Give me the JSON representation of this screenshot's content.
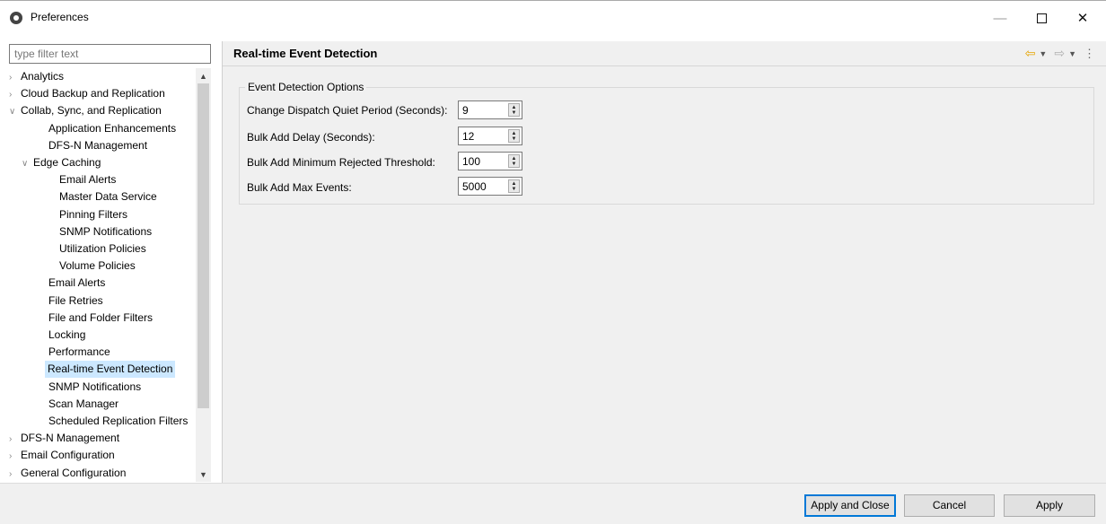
{
  "window": {
    "title": "Preferences",
    "minimize": "—",
    "close": "✕"
  },
  "filter": {
    "placeholder": "type filter text"
  },
  "tree": [
    {
      "label": "Analytics",
      "twisty": ">",
      "indent": 0
    },
    {
      "label": "Cloud Backup and Replication",
      "twisty": ">",
      "indent": 0
    },
    {
      "label": "Collab, Sync, and Replication",
      "twisty": "v",
      "indent": 0
    },
    {
      "label": "Application Enhancements",
      "twisty": "",
      "indent": 1
    },
    {
      "label": "DFS-N Management",
      "twisty": "",
      "indent": 1
    },
    {
      "label": "Edge Caching",
      "twisty": "v",
      "indent": 1
    },
    {
      "label": "Email Alerts",
      "twisty": "",
      "indent": 2
    },
    {
      "label": "Master Data Service",
      "twisty": "",
      "indent": 2
    },
    {
      "label": "Pinning Filters",
      "twisty": "",
      "indent": 2
    },
    {
      "label": "SNMP Notifications",
      "twisty": "",
      "indent": 2
    },
    {
      "label": "Utilization Policies",
      "twisty": "",
      "indent": 2
    },
    {
      "label": "Volume Policies",
      "twisty": "",
      "indent": 2
    },
    {
      "label": "Email Alerts",
      "twisty": "",
      "indent": 1
    },
    {
      "label": "File Retries",
      "twisty": "",
      "indent": 1
    },
    {
      "label": "File and Folder Filters",
      "twisty": "",
      "indent": 1
    },
    {
      "label": "Locking",
      "twisty": "",
      "indent": 1
    },
    {
      "label": "Performance",
      "twisty": "",
      "indent": 1
    },
    {
      "label": "Real-time Event Detection",
      "twisty": "",
      "indent": 1,
      "selected": true
    },
    {
      "label": "SNMP Notifications",
      "twisty": "",
      "indent": 1
    },
    {
      "label": "Scan Manager",
      "twisty": "",
      "indent": 1
    },
    {
      "label": "Scheduled Replication Filters",
      "twisty": "",
      "indent": 1
    },
    {
      "label": "DFS-N Management",
      "twisty": ">",
      "indent": 0
    },
    {
      "label": "Email Configuration",
      "twisty": ">",
      "indent": 0
    },
    {
      "label": "General Configuration",
      "twisty": ">",
      "indent": 0
    }
  ],
  "page": {
    "title": "Real-time Event Detection",
    "group_title": "Event Detection Options",
    "fields": [
      {
        "label": "Change Dispatch Quiet Period (Seconds):",
        "value": "9"
      },
      {
        "label": "Bulk Add Delay (Seconds):",
        "value": "12"
      },
      {
        "label": "Bulk Add Minimum Rejected Threshold:",
        "value": "100"
      },
      {
        "label": "Bulk Add Max Events:",
        "value": "5000"
      }
    ]
  },
  "buttons": {
    "apply_and_close": "Apply and Close",
    "cancel": "Cancel",
    "apply": "Apply"
  }
}
